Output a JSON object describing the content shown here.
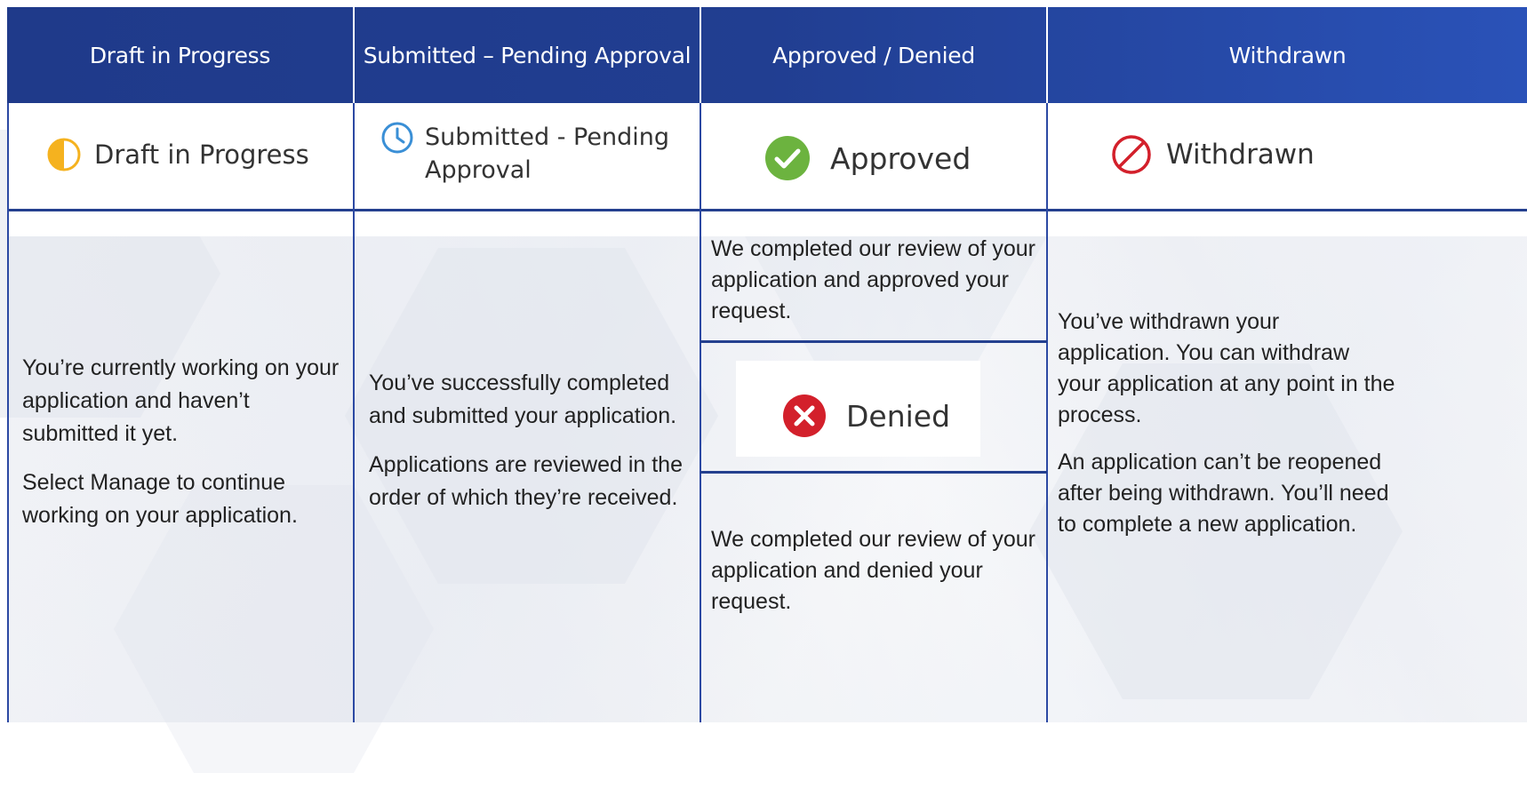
{
  "columns": [
    {
      "header": "Draft in Progress",
      "badge_label": "Draft in Progress",
      "badge_icon": "half-circle-icon",
      "paragraphs": [
        "You’re currently working on your application and haven’t submitted it yet.",
        "Select Manage to continue working on your application."
      ]
    },
    {
      "header": "Submitted – Pending Approval",
      "badge_label_line1": "Submitted - Pending",
      "badge_label_line2": "Approval",
      "badge_icon": "clock-icon",
      "paragraphs": [
        "You’ve successfully completed and submitted your application.",
        "Applications are reviewed in the order of which they’re received."
      ]
    },
    {
      "header": "Approved / Denied",
      "badge_label": "Approved",
      "badge_icon": "check-circle-icon",
      "approved_text": "We completed our review of your application and approved your request.",
      "denied_label": "Denied",
      "denied_icon": "x-circle-icon",
      "denied_text": "We completed our review of your application and denied your request."
    },
    {
      "header": "Withdrawn",
      "badge_label": "Withdrawn",
      "badge_icon": "prohibited-icon",
      "paragraphs": [
        "You’ve withdrawn your application. You can withdraw your application at any point in the process.",
        "An application can’t be reopened after being withdrawn. You’ll need to complete a new application."
      ]
    }
  ],
  "colors": {
    "header_bg": "#1f3a8a",
    "draft_icon": "#f5b21f",
    "clock_icon": "#3a8fd6",
    "approved_icon": "#6cb33f",
    "denied_icon": "#d3202b",
    "withdrawn_icon": "#d3202b"
  }
}
